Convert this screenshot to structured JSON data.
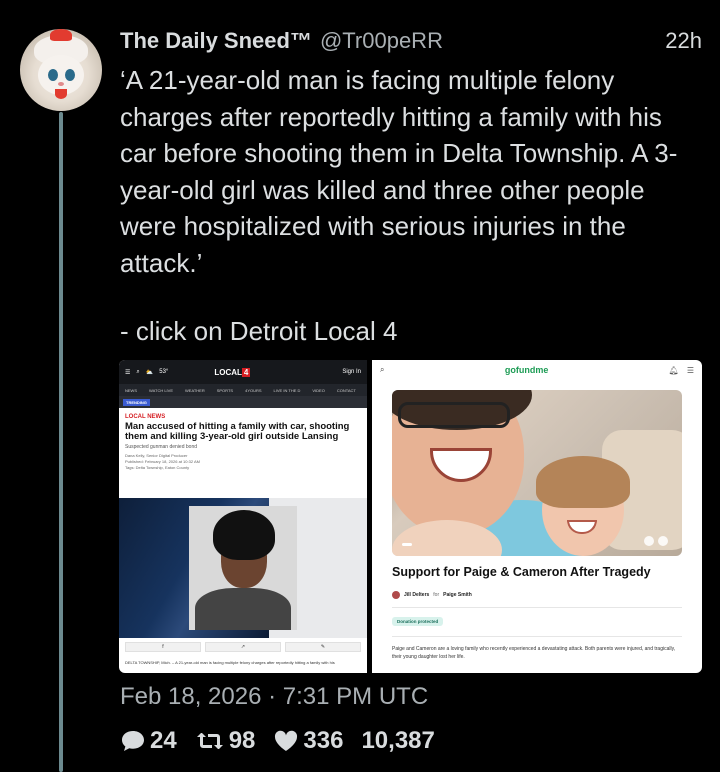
{
  "tweet": {
    "display_name": "The Daily Sneed™",
    "handle": "@Tr00peRR",
    "time": "22h",
    "text": "‘A 21-year-old man is facing multiple felony charges after reportedly hitting a family with his car before shooting them in Delta Township. A 3-year-old girl was killed and three other people were hospitalized with serious injuries in the attack.’",
    "link_text": "- click on Detroit Local 4",
    "timestamp": "Feb 18, 2026 · 7:31 PM UTC",
    "stats": {
      "replies": "24",
      "retweets": "98",
      "likes": "336",
      "views": "10,387"
    }
  },
  "news_card": {
    "weather": "53°",
    "logo_text": "LOCAL",
    "logo_number": "4",
    "signin": "Sign In",
    "menu": [
      "NEWS",
      "WATCH LIVE",
      "WEATHER",
      "SPORTS",
      "4YOURS",
      "LIVE IN THE D",
      "VIDEO",
      "CONTACT"
    ],
    "trending_tag": "TRENDING",
    "kicker": "LOCAL NEWS",
    "headline": "Man accused of hitting a family with car, shooting them and killing 3-year-old girl outside Lansing",
    "subhead": "Suspected gunman denied bond",
    "byline": "Dana Kelly, Senior Digital Producer",
    "published": "Published: February 18, 2026 at 10:32 AM",
    "tags": "Tags: Delta Township, Eaton County",
    "caption": "DELTA TOWNSHIP, Mich. – A 21-year-old man is facing multiple felony charges after reportedly hitting a family with his"
  },
  "gofundme_card": {
    "logo": "gofundme",
    "title": "Support for Paige & Cameron After Tragedy",
    "organizer_name": "Jill Delters",
    "organizer_for": "for",
    "beneficiary": "Paige Smith",
    "protected_label": "Donation protected",
    "description": "Paige and Cameron are a loving family who recently experienced a devastating attack. Both parents were injured, and tragically, their young daughter lost her life."
  },
  "icons": {
    "reply": "speech-bubble-icon",
    "retweet": "retweet-icon",
    "like": "heart-icon"
  },
  "colors": {
    "background": "#000000",
    "thread_line": "#6c8a8f",
    "text": "#dcdfe1",
    "gofundme_green": "#1d9c55",
    "local4_red": "#d51e23"
  }
}
